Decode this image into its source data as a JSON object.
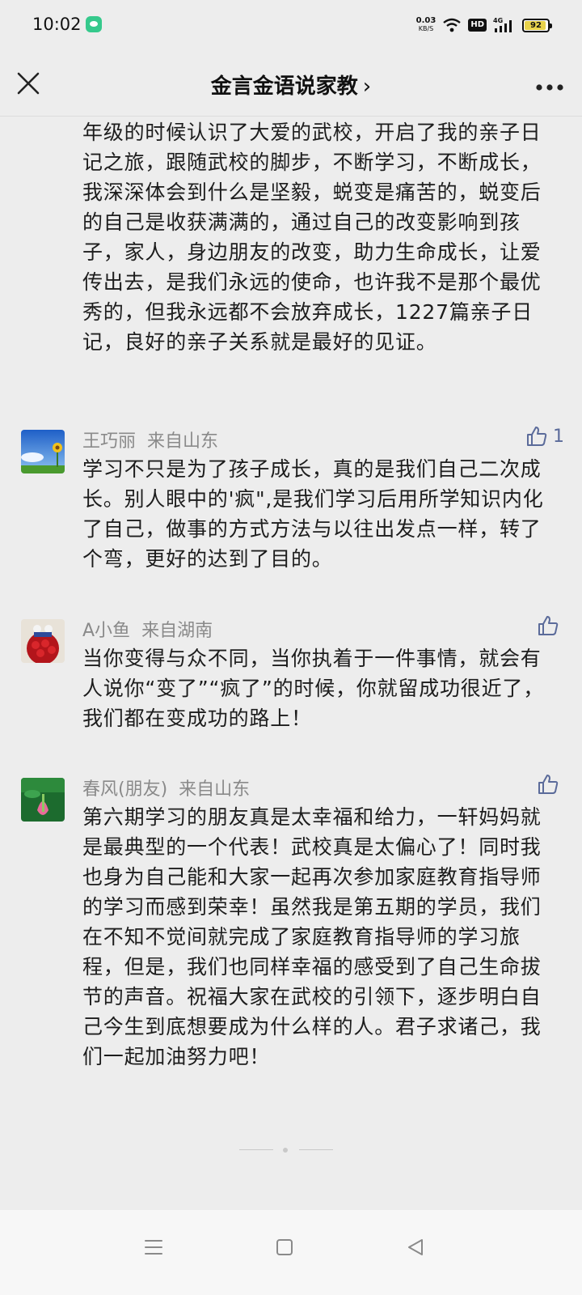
{
  "status_bar": {
    "time": "10:02",
    "net_speed_value": "0.03",
    "net_speed_unit": "KB/S",
    "hd_label": "HD",
    "network_label": "4G",
    "battery_level": "92"
  },
  "nav": {
    "title": "金言金语说家教",
    "chevron": "›"
  },
  "partial_comment": {
    "text": "年级的时候认识了大爱的武校，开启了我的亲子日记之旅，跟随武校的脚步，不断学习，不断成长，我深深体会到什么是坚毅，蜕变是痛苦的，蜕变后的自己是收获满满的，通过自己的改变影响到孩子，家人，身边朋友的改变，助力生命成长，让爱传出去，是我们永远的使命，也许我不是那个最优秀的，但我永远都不会放弃成长，1227篇亲子日记，良好的亲子关系就是最好的见证。"
  },
  "comments": [
    {
      "name": "王巧丽",
      "location": "来自山东",
      "likes": "1",
      "text": "学习不只是为了孩子成长，真的是我们自己二次成长。别人眼中的'疯\",是我们学习后用所学知识内化了自己，做事的方式方法与以往出发点一样，转了个弯，更好的达到了目的。"
    },
    {
      "name": "A小鱼",
      "location": "来自湖南",
      "likes": "",
      "text": "当你变得与众不同，当你执着于一件事情，就会有人说你“变了”“疯了”的时候，你就留成功很近了，我们都在变成功的路上！"
    },
    {
      "name": "春风(朋友)",
      "location": "来自山东",
      "likes": "",
      "text": "第六期学习的朋友真是太幸福和给力，一轩妈妈就是最典型的一个代表！武校真是太偏心了！同时我也身为自己能和大家一起再次参加家庭教育指导师的学习而感到荣幸！虽然我是第五期的学员，我们在不知不觉间就完成了家庭教育指导师的学习旅程，但是，我们也同样幸福的感受到了自己生命拔节的声音。祝福大家在武校的引领下，逐步明白自己今生到底想要成为什么样的人。君子求诸己，我们一起加油努力吧！"
    }
  ],
  "icons": {
    "close": "close-icon",
    "more": "more-icon",
    "like": "thumbs-up-icon",
    "menu": "menu-icon",
    "home": "home-icon",
    "back": "back-icon"
  },
  "colors": {
    "background": "#ededed",
    "like_accent": "#5b6b9a",
    "meta_text": "#8a8a8a"
  }
}
